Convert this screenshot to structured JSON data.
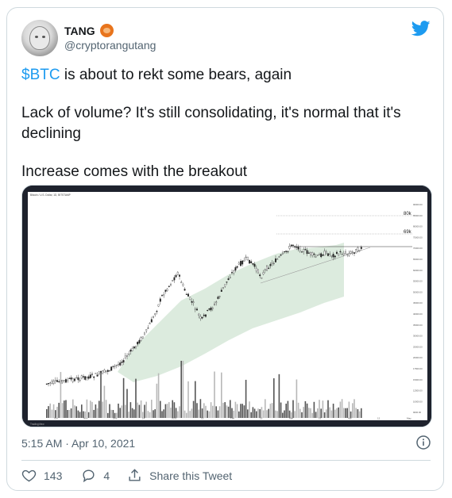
{
  "tweet": {
    "author_name": "TANG",
    "author_handle": "@cryptorangutang",
    "cashtag": "$BTC",
    "line1_rest": " is about to rekt some bears, again",
    "line2": "Lack of volume? It's still consolidating, it's normal that it's declining",
    "line3": "Increase comes with the breakout",
    "timestamp": "5:15 AM · Apr 10, 2021"
  },
  "actions": {
    "likes": "143",
    "replies": "4",
    "share_label": "Share this Tweet"
  },
  "colors": {
    "twitter_blue": "#1d9bf0",
    "text_primary": "#14171a",
    "text_secondary": "#536471",
    "chart_bg": "#ffffff",
    "fill_green": "#d6e8d8"
  },
  "icons": [
    "twitter-bird-icon",
    "info-icon",
    "heart-icon",
    "reply-icon",
    "share-icon"
  ],
  "chart_image": {
    "header_line": "Bitcoin / U.S. Dollar, 1D, BITSTAMP",
    "level_80k": "80k",
    "level_69k": "69k",
    "right_axis_ticks": [
      "90000.00",
      "85000.00",
      "80000.00",
      "75000.00",
      "70000.00",
      "65000.00",
      "60000.00",
      "55000.00",
      "50000.00",
      "45000.00",
      "40000.00",
      "35000.00",
      "30000.00",
      "25000.00",
      "20000.00",
      "17500.00",
      "15000.00",
      "12500.00",
      "10000.00",
      "9000.00"
    ],
    "x_ticks": [
      "Oct",
      "Nov",
      "Dec",
      "14",
      "2021",
      "15",
      "Feb",
      "15",
      "Mar",
      "15",
      "Apr",
      "12",
      "May"
    ],
    "watermark": "TradingView"
  }
}
